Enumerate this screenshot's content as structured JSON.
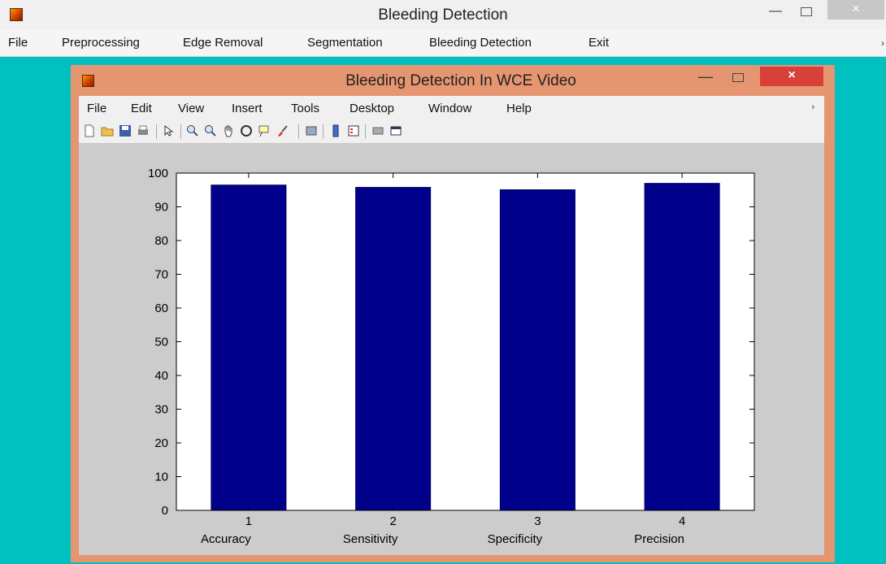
{
  "outer_window": {
    "title": "Bleeding Detection",
    "close_glyph": "×",
    "minimize_glyph": "—",
    "menu": [
      "File",
      "Preprocessing",
      "Edge Removal",
      "Segmentation",
      "Bleeding Detection",
      "Exit"
    ],
    "overflow_glyph": "›"
  },
  "figure_window": {
    "title": "Bleeding Detection In WCE Video",
    "close_glyph": "×",
    "minimize_glyph": "—",
    "menu": [
      "File",
      "Edit",
      "View",
      "Insert",
      "Tools",
      "Desktop",
      "Window",
      "Help"
    ],
    "overflow_glyph": "›",
    "toolbar_icons": [
      "new-figure-icon",
      "open-file-icon",
      "save-icon",
      "print-icon",
      "edit-plot-icon",
      "zoom-in-icon",
      "zoom-out-icon",
      "pan-icon",
      "rotate-3d-icon",
      "data-cursor-icon",
      "brush-icon",
      "link-plot-icon",
      "colorbar-icon",
      "legend-icon",
      "hide-tools-icon",
      "show-tools-icon"
    ]
  },
  "colors": {
    "bar": "#00008b",
    "background": "#00c0c0",
    "figure_frame": "#e69571",
    "figure_canvas": "#cccccc",
    "close_button": "#d9403a"
  },
  "chart_data": {
    "type": "bar",
    "categories": [
      "1",
      "2",
      "3",
      "4"
    ],
    "category_names": [
      "Accuracy",
      "Sensitivity",
      "Specificity",
      "Precision"
    ],
    "values": [
      96.5,
      95.8,
      95.1,
      97.0
    ],
    "ylim": [
      0,
      100
    ],
    "yticks": [
      0,
      10,
      20,
      30,
      40,
      50,
      60,
      70,
      80,
      90,
      100
    ],
    "title": "",
    "xlabel": "",
    "ylabel": "",
    "grid": false,
    "legend": "none"
  }
}
